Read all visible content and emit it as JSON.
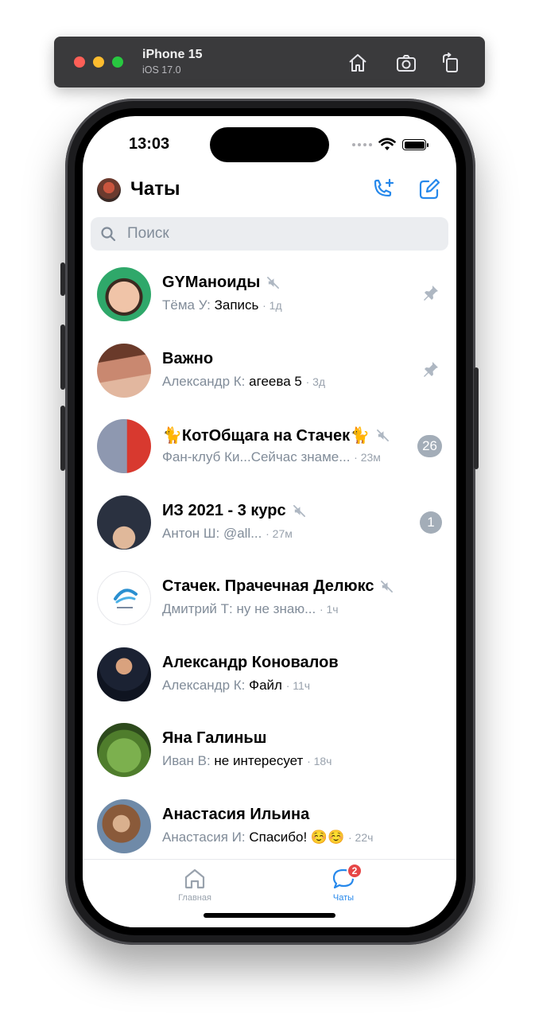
{
  "simulator": {
    "device_name": "iPhone 15",
    "os_version": "iOS 17.0",
    "icons": [
      "home-icon",
      "screenshot-icon",
      "rotate-icon"
    ]
  },
  "status_bar": {
    "time": "13:03"
  },
  "header": {
    "title": "Чаты",
    "buttons": [
      "add-call-icon",
      "compose-icon"
    ],
    "accent_color": "#2688eb"
  },
  "search": {
    "placeholder": "Поиск"
  },
  "chats": [
    {
      "title": "GYМаноиды",
      "muted": true,
      "sender": "Тёма У:",
      "message": "Запись",
      "time": "· 1д",
      "pinned": true,
      "unread": null
    },
    {
      "title": "Важно",
      "muted": false,
      "sender": "Александр К:",
      "message": "агеева 5",
      "time": "· 3д",
      "pinned": true,
      "unread": null
    },
    {
      "title": "🐈КотОбщага на Стачек🐈",
      "muted": true,
      "sender": "Фан-клуб Ки...",
      "message": "Сейчас знаме...",
      "time": "· 23м",
      "pinned": false,
      "unread": "26"
    },
    {
      "title": "ИЗ 2021 - 3 курс",
      "muted": true,
      "sender": "Антон Ш:",
      "message": "@all...",
      "time": "· 27м",
      "pinned": false,
      "unread": "1"
    },
    {
      "title": "Стачек. Прачечная Делюкс",
      "muted": true,
      "sender": "Дмитрий Т:",
      "message": "ну не знаю...",
      "time": "· 1ч",
      "pinned": false,
      "unread": null
    },
    {
      "title": "Александр Коновалов",
      "muted": false,
      "sender": "Александр К:",
      "message": "Файл",
      "time": "· 11ч",
      "pinned": false,
      "unread": null
    },
    {
      "title": "Яна Галиньш",
      "muted": false,
      "sender": "Иван В:",
      "message": "не интересует",
      "time": "· 18ч",
      "pinned": false,
      "unread": null
    },
    {
      "title": "Анастасия Ильина",
      "muted": false,
      "sender": "Анастасия И:",
      "message": "Спасибо! ☺️☺️",
      "time": "· 22ч",
      "pinned": false,
      "unread": null
    }
  ],
  "tabbar": {
    "home_label": "Главная",
    "chats_label": "Чаты",
    "chats_badge": "2"
  }
}
